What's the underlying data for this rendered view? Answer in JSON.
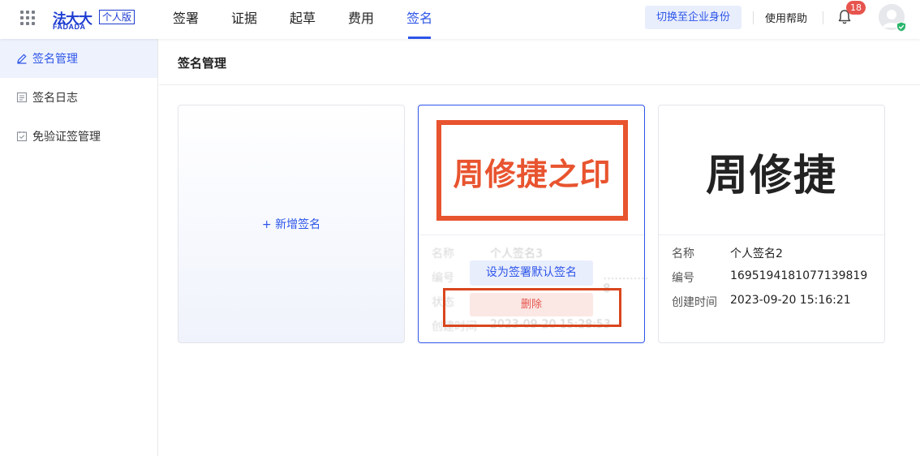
{
  "brand": {
    "logo_text": "法大大",
    "logo_sub": "FADADA",
    "edition": "个人版"
  },
  "nav": {
    "items": [
      {
        "label": "签署"
      },
      {
        "label": "证据"
      },
      {
        "label": "起草"
      },
      {
        "label": "费用"
      },
      {
        "label": "签名",
        "active": true
      }
    ]
  },
  "header": {
    "switch_label": "切换至企业身份",
    "help_label": "使用帮助",
    "notification_count": "18",
    "icons": [
      "apps-grid-icon",
      "bell-icon",
      "avatar",
      "verified-icon"
    ]
  },
  "sidebar": {
    "items": [
      {
        "label": "签名管理",
        "icon": "pen-icon",
        "active": true
      },
      {
        "label": "签名日志",
        "icon": "log-icon"
      },
      {
        "label": "免验证签管理",
        "icon": "shield-check-icon"
      }
    ]
  },
  "main": {
    "title": "签名管理",
    "add_label": "+ 新增签名",
    "cards": [
      {
        "seal_text": "周修捷之印",
        "rows": [
          {
            "key": "名称",
            "value": "个人签名3"
          },
          {
            "key": "编号",
            "value": "…………8"
          },
          {
            "key": "状态",
            "value": ""
          },
          {
            "key": "创建时间",
            "value": "2023-09-20 15:28:53"
          }
        ],
        "set_default_label": "设为签署默认签名",
        "delete_label": "删除"
      },
      {
        "signature_text": "周修捷",
        "rows": [
          {
            "key": "名称",
            "value": "个人签名2"
          },
          {
            "key": "编号",
            "value": "1695194181077139819"
          },
          {
            "key": "创建时间",
            "value": "2023-09-20 15:16:21"
          }
        ]
      }
    ]
  },
  "colors": {
    "accent": "#2d55e8",
    "seal_red": "#e8542f",
    "highlight": "#d9461d",
    "danger": "#e6544d"
  }
}
